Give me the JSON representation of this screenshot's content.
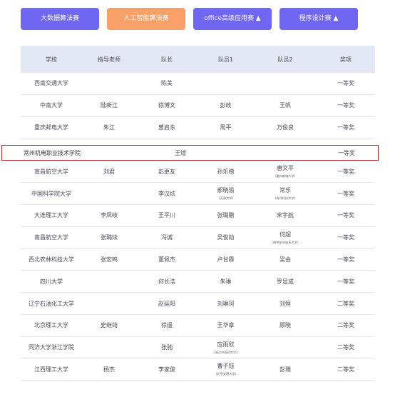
{
  "tabs": [
    {
      "label": "大数据算法赛"
    },
    {
      "label": "人工智能算法赛"
    },
    {
      "label": "office高级应用赛 ▲"
    },
    {
      "label": "程序设计赛 ▲"
    }
  ],
  "table": {
    "headers": [
      "学校",
      "指导老师",
      "队长",
      "队员1",
      "队员2",
      "奖项"
    ],
    "rows_before": [
      {
        "school": "西南交通大学",
        "teacher": "",
        "captain": "陈美",
        "m1": "",
        "m1_sub": "",
        "m2": "",
        "m2_sub": "",
        "award": "一等奖"
      },
      {
        "school": "中南大学",
        "teacher": "陆新江",
        "captain": "徐博文",
        "m1": "彭政",
        "m1_sub": "",
        "m2": "王帆",
        "m2_sub": "",
        "award": "一等奖"
      },
      {
        "school": "重庆邮电大学",
        "teacher": "朱江",
        "captain": "曾启东",
        "m1": "周平",
        "m1_sub": "",
        "m2": "万俊良",
        "m2_sub": "",
        "award": "一等奖"
      }
    ],
    "highlighted": {
      "school": "常州机电职业技术学院",
      "captain": "王煊",
      "award": "一等奖"
    },
    "rows_after": [
      {
        "school": "南昌航空大学",
        "teacher": "刘君",
        "captain": "彭更友",
        "m1": "孙乐梯",
        "m1_sub": "",
        "m2": "唐文平",
        "m2_sub": "(重庆邮电大学)",
        "award": "一等奖"
      },
      {
        "school": "中国科学院大学",
        "teacher": "",
        "captain": "李汉炫",
        "m1": "郝晓渝",
        "m1_sub": "(天津大学)",
        "m2": "常乐",
        "m2_sub": "(海洋科技大学)",
        "award": "一等奖"
      },
      {
        "school": "大连理工大学",
        "teacher": "李凤岐",
        "captain": "王平川",
        "m1": "张璐鹏",
        "m1_sub": "",
        "m2": "宋宇航",
        "m2_sub": "",
        "award": "一等奖"
      },
      {
        "school": "南昌航空大学",
        "teacher": "张璐炫",
        "captain": "冯诚",
        "m1": "吴俊劼",
        "m1_sub": "",
        "m2": "何超",
        "m2_sub": "(南京航空航天大学)",
        "award": "一等奖"
      },
      {
        "school": "西北农林科技大学",
        "teacher": "张宏鸣",
        "captain": "董佩杰",
        "m1": "卢甘霖",
        "m1_sub": "",
        "m2": "梁会",
        "m2_sub": "",
        "award": "一等奖"
      },
      {
        "school": "四川大学",
        "teacher": "",
        "captain": "何长浩",
        "m1": "朱琳",
        "m1_sub": "",
        "m2": "罗显成",
        "m2_sub": "",
        "award": "一等奖"
      },
      {
        "school": "辽宁石油化工大学",
        "teacher": "",
        "captain": "赵廷阳",
        "m1": "刘琳珂",
        "m1_sub": "",
        "m2": "刘恒",
        "m2_sub": "",
        "award": "二等奖"
      },
      {
        "school": "北京理工大学",
        "teacher": "史继筠",
        "captain": "徐遥",
        "m1": "王华章",
        "m1_sub": "",
        "m2": "顾晓",
        "m2_sub": "",
        "award": "二等奖"
      },
      {
        "school": "同济大学浙江学院",
        "teacher": "",
        "captain": "张驰",
        "m1": "应雨欣",
        "m1_sub": "(浙江中医药大学)",
        "m2": "",
        "m2_sub": "",
        "award": "二等奖"
      },
      {
        "school": "江西理工大学",
        "teacher": "杨杰",
        "captain": "李家俊",
        "m1": "曹子钰",
        "m1_sub": "(北京交通大学)",
        "m2": "彭珊",
        "m2_sub": "",
        "award": "二等奖"
      }
    ]
  },
  "colors": {
    "tab_purple": "#6f66f2",
    "tab_orange": "#f8a068",
    "header_bg": "#e3e8f6",
    "highlight_border": "#b8272d"
  }
}
